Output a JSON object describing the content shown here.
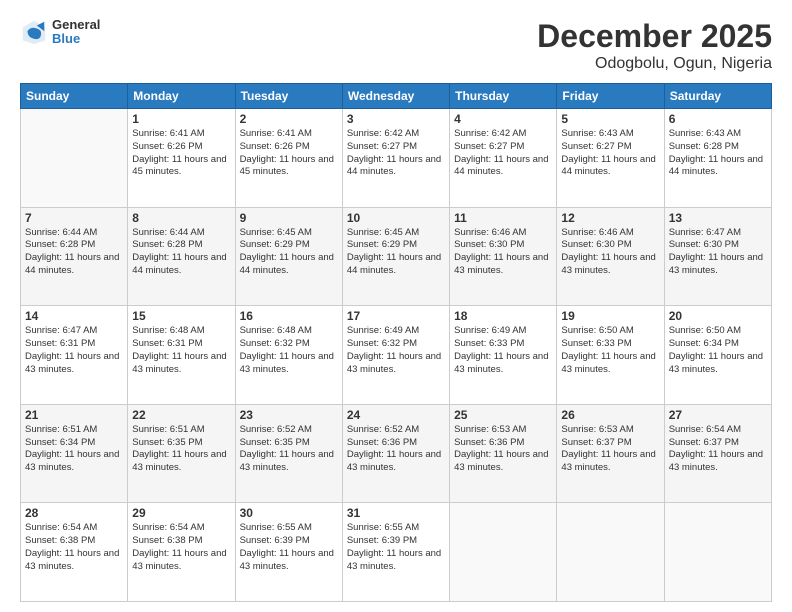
{
  "header": {
    "logo": {
      "general": "General",
      "blue": "Blue"
    },
    "title": "December 2025",
    "subtitle": "Odogbolu, Ogun, Nigeria"
  },
  "calendar": {
    "days_of_week": [
      "Sunday",
      "Monday",
      "Tuesday",
      "Wednesday",
      "Thursday",
      "Friday",
      "Saturday"
    ],
    "weeks": [
      [
        {
          "day": "",
          "info": ""
        },
        {
          "day": "1",
          "info": "Sunrise: 6:41 AM\nSunset: 6:26 PM\nDaylight: 11 hours and 45 minutes."
        },
        {
          "day": "2",
          "info": "Sunrise: 6:41 AM\nSunset: 6:26 PM\nDaylight: 11 hours and 45 minutes."
        },
        {
          "day": "3",
          "info": "Sunrise: 6:42 AM\nSunset: 6:27 PM\nDaylight: 11 hours and 44 minutes."
        },
        {
          "day": "4",
          "info": "Sunrise: 6:42 AM\nSunset: 6:27 PM\nDaylight: 11 hours and 44 minutes."
        },
        {
          "day": "5",
          "info": "Sunrise: 6:43 AM\nSunset: 6:27 PM\nDaylight: 11 hours and 44 minutes."
        },
        {
          "day": "6",
          "info": "Sunrise: 6:43 AM\nSunset: 6:28 PM\nDaylight: 11 hours and 44 minutes."
        }
      ],
      [
        {
          "day": "7",
          "info": "Sunrise: 6:44 AM\nSunset: 6:28 PM\nDaylight: 11 hours and 44 minutes."
        },
        {
          "day": "8",
          "info": "Sunrise: 6:44 AM\nSunset: 6:28 PM\nDaylight: 11 hours and 44 minutes."
        },
        {
          "day": "9",
          "info": "Sunrise: 6:45 AM\nSunset: 6:29 PM\nDaylight: 11 hours and 44 minutes."
        },
        {
          "day": "10",
          "info": "Sunrise: 6:45 AM\nSunset: 6:29 PM\nDaylight: 11 hours and 44 minutes."
        },
        {
          "day": "11",
          "info": "Sunrise: 6:46 AM\nSunset: 6:30 PM\nDaylight: 11 hours and 43 minutes."
        },
        {
          "day": "12",
          "info": "Sunrise: 6:46 AM\nSunset: 6:30 PM\nDaylight: 11 hours and 43 minutes."
        },
        {
          "day": "13",
          "info": "Sunrise: 6:47 AM\nSunset: 6:30 PM\nDaylight: 11 hours and 43 minutes."
        }
      ],
      [
        {
          "day": "14",
          "info": "Sunrise: 6:47 AM\nSunset: 6:31 PM\nDaylight: 11 hours and 43 minutes."
        },
        {
          "day": "15",
          "info": "Sunrise: 6:48 AM\nSunset: 6:31 PM\nDaylight: 11 hours and 43 minutes."
        },
        {
          "day": "16",
          "info": "Sunrise: 6:48 AM\nSunset: 6:32 PM\nDaylight: 11 hours and 43 minutes."
        },
        {
          "day": "17",
          "info": "Sunrise: 6:49 AM\nSunset: 6:32 PM\nDaylight: 11 hours and 43 minutes."
        },
        {
          "day": "18",
          "info": "Sunrise: 6:49 AM\nSunset: 6:33 PM\nDaylight: 11 hours and 43 minutes."
        },
        {
          "day": "19",
          "info": "Sunrise: 6:50 AM\nSunset: 6:33 PM\nDaylight: 11 hours and 43 minutes."
        },
        {
          "day": "20",
          "info": "Sunrise: 6:50 AM\nSunset: 6:34 PM\nDaylight: 11 hours and 43 minutes."
        }
      ],
      [
        {
          "day": "21",
          "info": "Sunrise: 6:51 AM\nSunset: 6:34 PM\nDaylight: 11 hours and 43 minutes."
        },
        {
          "day": "22",
          "info": "Sunrise: 6:51 AM\nSunset: 6:35 PM\nDaylight: 11 hours and 43 minutes."
        },
        {
          "day": "23",
          "info": "Sunrise: 6:52 AM\nSunset: 6:35 PM\nDaylight: 11 hours and 43 minutes."
        },
        {
          "day": "24",
          "info": "Sunrise: 6:52 AM\nSunset: 6:36 PM\nDaylight: 11 hours and 43 minutes."
        },
        {
          "day": "25",
          "info": "Sunrise: 6:53 AM\nSunset: 6:36 PM\nDaylight: 11 hours and 43 minutes."
        },
        {
          "day": "26",
          "info": "Sunrise: 6:53 AM\nSunset: 6:37 PM\nDaylight: 11 hours and 43 minutes."
        },
        {
          "day": "27",
          "info": "Sunrise: 6:54 AM\nSunset: 6:37 PM\nDaylight: 11 hours and 43 minutes."
        }
      ],
      [
        {
          "day": "28",
          "info": "Sunrise: 6:54 AM\nSunset: 6:38 PM\nDaylight: 11 hours and 43 minutes."
        },
        {
          "day": "29",
          "info": "Sunrise: 6:54 AM\nSunset: 6:38 PM\nDaylight: 11 hours and 43 minutes."
        },
        {
          "day": "30",
          "info": "Sunrise: 6:55 AM\nSunset: 6:39 PM\nDaylight: 11 hours and 43 minutes."
        },
        {
          "day": "31",
          "info": "Sunrise: 6:55 AM\nSunset: 6:39 PM\nDaylight: 11 hours and 43 minutes."
        },
        {
          "day": "",
          "info": ""
        },
        {
          "day": "",
          "info": ""
        },
        {
          "day": "",
          "info": ""
        }
      ]
    ]
  }
}
